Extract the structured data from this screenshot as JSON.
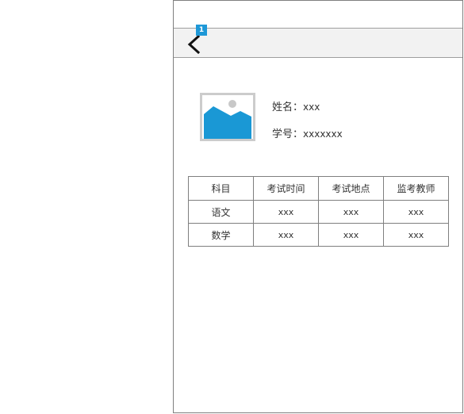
{
  "header": {
    "badge": "1",
    "back_icon": "chevron-left-icon",
    "accent_color": "#1e98d7"
  },
  "student": {
    "avatar_icon": "image-placeholder-icon",
    "name_label": "姓名：",
    "name_value": "xxx",
    "id_label": "学号：",
    "id_value": "xxxxxxx"
  },
  "table": {
    "headers": [
      "科目",
      "考试时间",
      "考试地点",
      "监考教师"
    ],
    "rows": [
      [
        "语文",
        "xxx",
        "xxx",
        "xxx"
      ],
      [
        "数学",
        "xxx",
        "xxx",
        "xxx"
      ]
    ]
  }
}
